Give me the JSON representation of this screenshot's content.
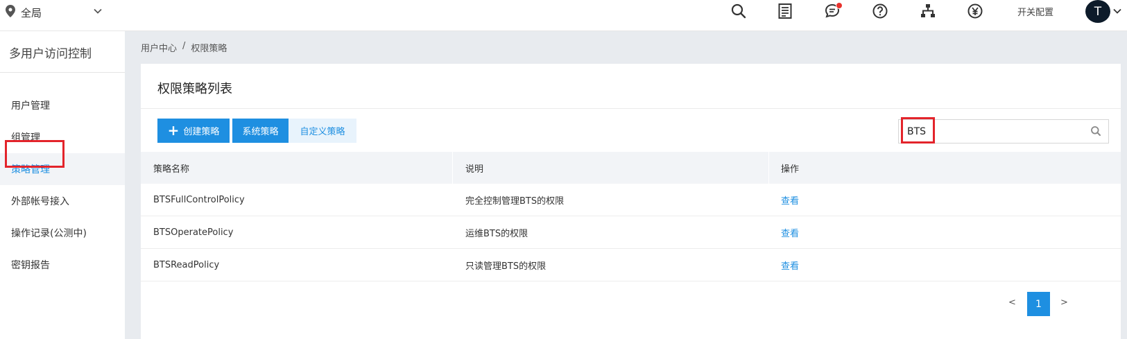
{
  "topbar": {
    "region_label": "全局",
    "icons": [
      "search-icon",
      "document-list-icon",
      "message-icon",
      "help-icon",
      "network-icon",
      "currency-icon"
    ],
    "switch_config_label": "开关配置",
    "avatar_letter": "T"
  },
  "sidebar": {
    "title": "多用户访问控制",
    "items": [
      {
        "label": "用户管理"
      },
      {
        "label": "组管理"
      },
      {
        "label": "策略管理"
      },
      {
        "label": "外部帐号接入"
      },
      {
        "label": "操作记录(公测中)"
      },
      {
        "label": "密钥报告"
      }
    ],
    "active_index": 2
  },
  "breadcrumb": {
    "root": "用户中心",
    "separator": "/",
    "current": "权限策略"
  },
  "panel": {
    "title": "权限策略列表",
    "create_button": "创建策略",
    "system_policy_tab": "系统策略",
    "custom_policy_tab": "自定义策略",
    "search_value": "BTS"
  },
  "table": {
    "headers": [
      "策略名称",
      "说明",
      "操作"
    ],
    "rows": [
      {
        "name": "BTSFullControlPolicy",
        "desc": "完全控制管理BTS的权限",
        "action": "查看"
      },
      {
        "name": "BTSOperatePolicy",
        "desc": "运维BTS的权限",
        "action": "查看"
      },
      {
        "name": "BTSReadPolicy",
        "desc": "只读管理BTS的权限",
        "action": "查看"
      }
    ]
  },
  "pagination": {
    "prev": "<",
    "current_page": "1",
    "next": ">"
  },
  "colors": {
    "accent": "#1e8fe1",
    "highlight_box": "#e3242b",
    "notification_dot": "#e8322d"
  }
}
